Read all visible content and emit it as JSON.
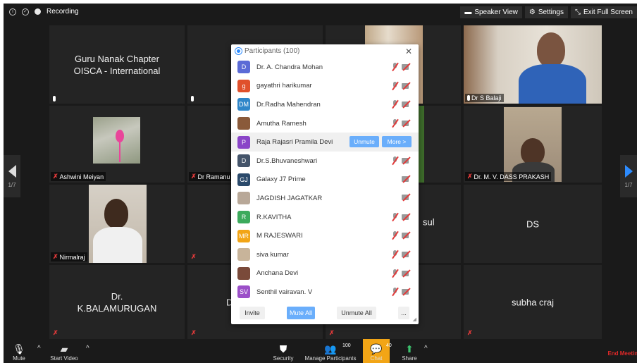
{
  "topbar": {
    "recording_label": "Recording",
    "speaker_view_label": "Speaker View",
    "settings_label": "Settings",
    "exit_fullscreen_label": "Exit Full Screen"
  },
  "tiles": {
    "t1_text": "Guru Nanak Chapter\nOISCA - International",
    "ashwini": "Ashwini Meiyan",
    "ramanu": "Dr Ramanu",
    "nirmalraj": "Nirmalraj",
    "balaji": "Dr S Balaji",
    "dass": "Dr. M. V. DASS PRAKASH",
    "ds": "DS",
    "balamurugan": "Dr.\nK.BALAMURUGAN",
    "subha": "subha craj",
    "partial_sul": "sul",
    "partial_d": "D"
  },
  "nav": {
    "left_page": "1/7",
    "right_page": "1/7"
  },
  "panel": {
    "title": "Participants (100)",
    "participants": [
      {
        "initials": "D",
        "name": "Dr. A. Chandra Mohan",
        "color": "#5b6bd6"
      },
      {
        "initials": "g",
        "name": "gayathri harikumar",
        "color": "#e0502b"
      },
      {
        "initials": "DM",
        "name": "Dr.Radha Mahendran",
        "color": "#2f86c9"
      },
      {
        "initials": "",
        "name": "Amutha Ramesh",
        "color": "#8a5a3a"
      },
      {
        "initials": "P",
        "name": "Raja Rajasri Pramila Devi",
        "color": "#8a45c8"
      },
      {
        "initials": "D",
        "name": "Dr.S.Bhuvaneshwari",
        "color": "#44546a"
      },
      {
        "initials": "GJ",
        "name": "Galaxy J7 Prime",
        "color": "#2b4a6b"
      },
      {
        "initials": "",
        "name": "JAGDISH JAGATKAR",
        "color": "#b8a898"
      },
      {
        "initials": "R",
        "name": "R.KAVITHA",
        "color": "#3caa5c"
      },
      {
        "initials": "MR",
        "name": "M RAJESWARI",
        "color": "#f2a516"
      },
      {
        "initials": "",
        "name": "siva kumar",
        "color": "#c8b49a"
      },
      {
        "initials": "",
        "name": "Anchana Devi",
        "color": "#7a4a3a"
      },
      {
        "initials": "SV",
        "name": "Senthil vairavan. V",
        "color": "#9b4fc8"
      }
    ],
    "unmute_label": "Unmute",
    "more_label": "More >",
    "invite_label": "Invite",
    "mute_all_label": "Mute All",
    "unmute_all_label": "Unmute All",
    "ellipsis_label": "..."
  },
  "bottombar": {
    "mute_label": "Mute",
    "start_video_label": "Start Video",
    "security_label": "Security",
    "manage_participants_label": "Manage Participants",
    "participant_count": "100",
    "chat_label": "Chat",
    "chat_count": "40",
    "share_label": "Share",
    "end_meeting_label": "End Meeting"
  }
}
